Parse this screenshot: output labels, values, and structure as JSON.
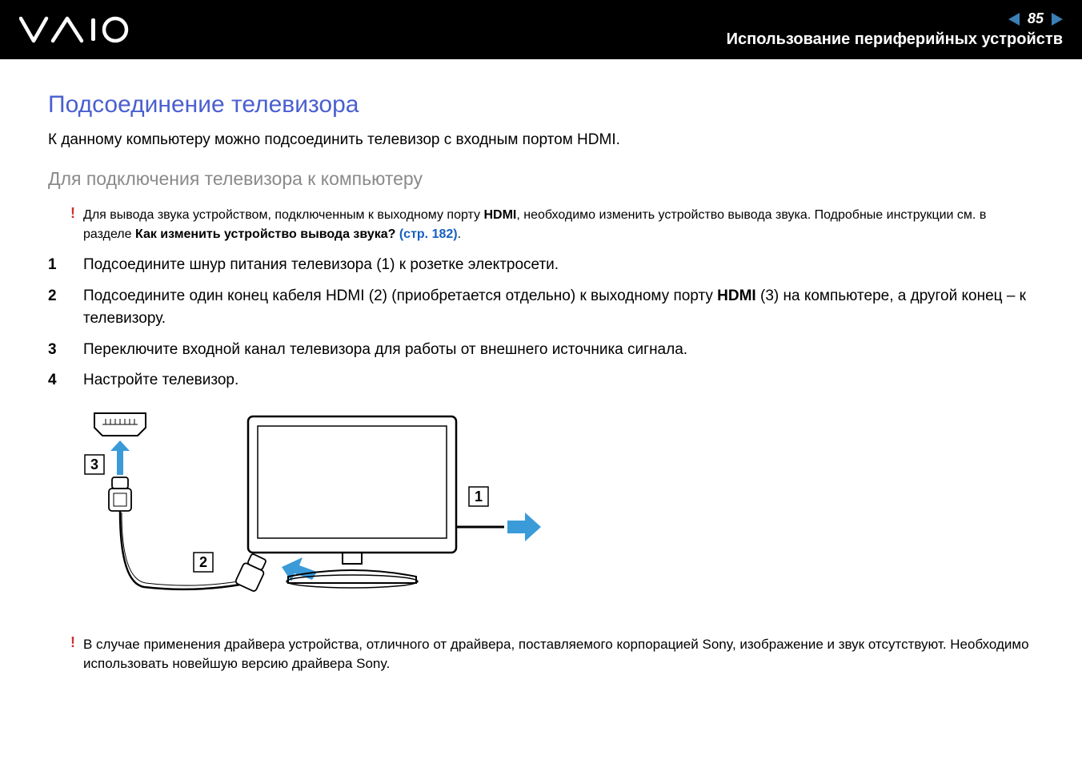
{
  "header": {
    "page_number": "85",
    "breadcrumb": "Использование периферийных устройств"
  },
  "content": {
    "title": "Подсоединение телевизора",
    "intro": "К данному компьютеру можно подсоединить телевизор с входным портом HDMI.",
    "subtitle": "Для подключения телевизора к компьютеру",
    "warning1_part1": "Для вывода звука устройством, подключенным к выходному порту ",
    "warning1_bold1": "HDMI",
    "warning1_part2": ", необходимо изменить устройство вывода звука. Подробные инструкции см. в разделе ",
    "warning1_bold2": "Как изменить устройство вывода звука? ",
    "warning1_link": "(стр. 182)",
    "warning1_part3": ".",
    "steps": [
      {
        "n": "1",
        "text_a": "Подсоедините шнур питания телевизора (1) к розетке электросети."
      },
      {
        "n": "2",
        "text_a": "Подсоедините один конец кабеля HDMI (2) (приобретается отдельно) к выходному порту ",
        "bold": "HDMI",
        "text_b": " (3) на компьютере, а другой конец – к телевизору."
      },
      {
        "n": "3",
        "text_a": "Переключите входной канал телевизора для работы от внешнего источника сигнала."
      },
      {
        "n": "4",
        "text_a": "Настройте телевизор."
      }
    ],
    "diagram": {
      "label1": "1",
      "label2": "2",
      "label3": "3"
    },
    "warning2": "В случае применения драйвера устройства, отличного от драйвера, поставляемого корпорацией Sony, изображение и звук отсутствуют. Необходимо использовать новейшую версию драйвера Sony."
  }
}
